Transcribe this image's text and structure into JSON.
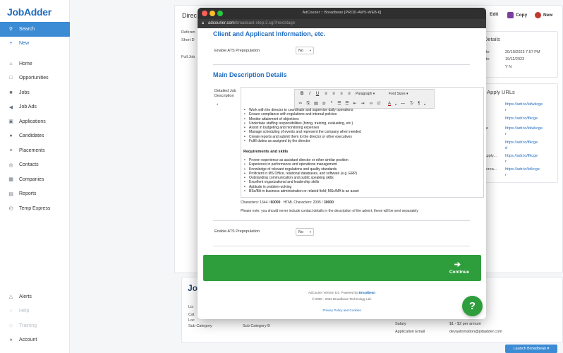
{
  "app": {
    "logo": "JobAdder"
  },
  "sidebar": {
    "items": [
      {
        "label": "Search",
        "icon": "search-icon",
        "state": "active"
      },
      {
        "label": "New",
        "icon": "plus-icon",
        "state": "blue"
      },
      {
        "label": "Home",
        "icon": "home-icon",
        "state": "normal"
      },
      {
        "label": "Opportunities",
        "icon": "opportunities-icon",
        "state": "normal"
      },
      {
        "label": "Jobs",
        "icon": "briefcase-icon",
        "state": "normal"
      },
      {
        "label": "Job Ads",
        "icon": "megaphone-icon",
        "state": "normal"
      },
      {
        "label": "Applications",
        "icon": "inbox-icon",
        "state": "normal"
      },
      {
        "label": "Candidates",
        "icon": "people-icon",
        "state": "normal"
      },
      {
        "label": "Placements",
        "icon": "placement-icon",
        "state": "normal"
      },
      {
        "label": "Contacts",
        "icon": "contact-icon",
        "state": "normal"
      },
      {
        "label": "Companies",
        "icon": "building-icon",
        "state": "normal"
      },
      {
        "label": "Reports",
        "icon": "reports-icon",
        "state": "normal"
      },
      {
        "label": "Temp Express",
        "icon": "clock-icon",
        "state": "normal"
      }
    ],
    "bottom": [
      {
        "label": "Alerts",
        "icon": "bell-icon",
        "state": "normal"
      },
      {
        "label": "Help",
        "icon": "help-icon",
        "state": "disabled"
      },
      {
        "label": "Training",
        "icon": "training-icon",
        "state": "disabled"
      },
      {
        "label": "Account",
        "icon": "user-icon",
        "state": "normal"
      }
    ]
  },
  "background": {
    "page_title": "Direc",
    "actions": {
      "edit": "Edit",
      "copy": "Copy",
      "new": "New"
    },
    "left_labels": [
      "Referen",
      "Short D",
      "Full Job"
    ],
    "details_title": "Details",
    "details_rows": [
      {
        "k": "ate",
        "v": "20/10/2023 7:57 PM"
      },
      {
        "k": "ate",
        "v": "19/11/2023"
      },
      {
        "k": "",
        "v": "Y N"
      }
    ],
    "apply_title": "r Apply URLs",
    "apply_links": [
      {
        "k": "",
        "v": "https://adr.to/lafwkcge"
      },
      {
        "k": "",
        "v": "r"
      },
      {
        "k": "",
        "v": "https://adr.to/lfkcge"
      },
      {
        "k": "de",
        "v": "https://adr.to/lolwkcge"
      },
      {
        "k": "",
        "v": "r"
      },
      {
        "k": "",
        "v": "https://adr.to/lfkcge"
      },
      {
        "k": "",
        "v": "d"
      },
      {
        "k": "Apply...",
        "v": "https://adr.to/lfkcge"
      },
      {
        "k": "",
        "v": "r"
      },
      {
        "k": "ecrea...",
        "v": "https://adr.to/lolkcge"
      },
      {
        "k": "",
        "v": "r"
      }
    ],
    "bottom_title": "Jo",
    "bottom_rows": [
      {
        "k": "Lis",
        "v": ""
      },
      {
        "k": "Cat",
        "v": ""
      },
      {
        "k": "Loc",
        "v": ""
      },
      {
        "k": "Sub Category",
        "v": "Sub Category B"
      }
    ],
    "bottom_right": [
      {
        "k": "Salary",
        "v": "$1 - $2 per annum"
      },
      {
        "k": "Application Email",
        "v": "devautomation@jobadder.com"
      }
    ],
    "launch_button": "Launch Broadbean ▾"
  },
  "window": {
    "title": "AdCourier :: Broadbean [PROD-AWS-WEB-6]",
    "url_host": "adcourier.com",
    "url_path": "/broadcast-step-2.cgi?nextstage",
    "section1_title": "Client and Applicant Information, etc.",
    "ats_label": "Enable ATS Prepopulation",
    "ats_value": "No",
    "section2_title": "Main Description Details",
    "desc_label": "Detailed Job Description",
    "required_mark": "*",
    "toolbar": {
      "paragraph": "Paragraph",
      "font_sizes": "Font Sizes"
    },
    "description": {
      "list1": [
        "Work with the director to coordinate and supervise daily operations",
        "Ensure compliance with regulations and internal policies",
        "Monitor attainment of objectives",
        "Undertake staffing responsibilities (hiring, training, evaluating, etc.)",
        "Assist in budgeting and monitoring expenses",
        "Manage scheduling of events and represent the company when needed",
        "Create reports and submit them to the director or other executives",
        "Fulfil duties as assigned by the director"
      ],
      "heading": "Requirements and skills",
      "list2": [
        "Proven experience as assistant director or other similar position",
        "Experience in performance and operations management",
        "Knowledge of relevant regulations and quality standards",
        "Proficient in MS Office, relational databases, and software (e.g. ERP)",
        "Outstanding communication and public speaking skills",
        "Excellent organizational and leadership skills",
        "Aptitude in problem-solving",
        "BSc/BA in business administration or related field; MSc/MA is an asset"
      ]
    },
    "char_count": "Characters: 1644 / ",
    "char_max": "60000",
    "html_count": "   HTML Characters: 2095 / ",
    "html_max": "30000",
    "note": "Please note: you should never include contact details in the description of the advert, these will be sent separately",
    "ats_label2": "Enable ATS Prepopulation",
    "ats_value2": "No",
    "continue_label": "Continue",
    "footer1_prefix": "AdCourier Version 8.0. Powered by ",
    "footer1_link": "Broadbean",
    "footer2": "© 2000 - 2023 Broadbean Technology Ltd.",
    "footer3": "Privacy Policy and Cookies",
    "help_label": "?"
  },
  "colors": {
    "brand_blue": "#1e6bbf",
    "active_nav": "#3b8bd5",
    "continue_green": "#2e9e3c",
    "titlebar": "#2f2f2f"
  }
}
